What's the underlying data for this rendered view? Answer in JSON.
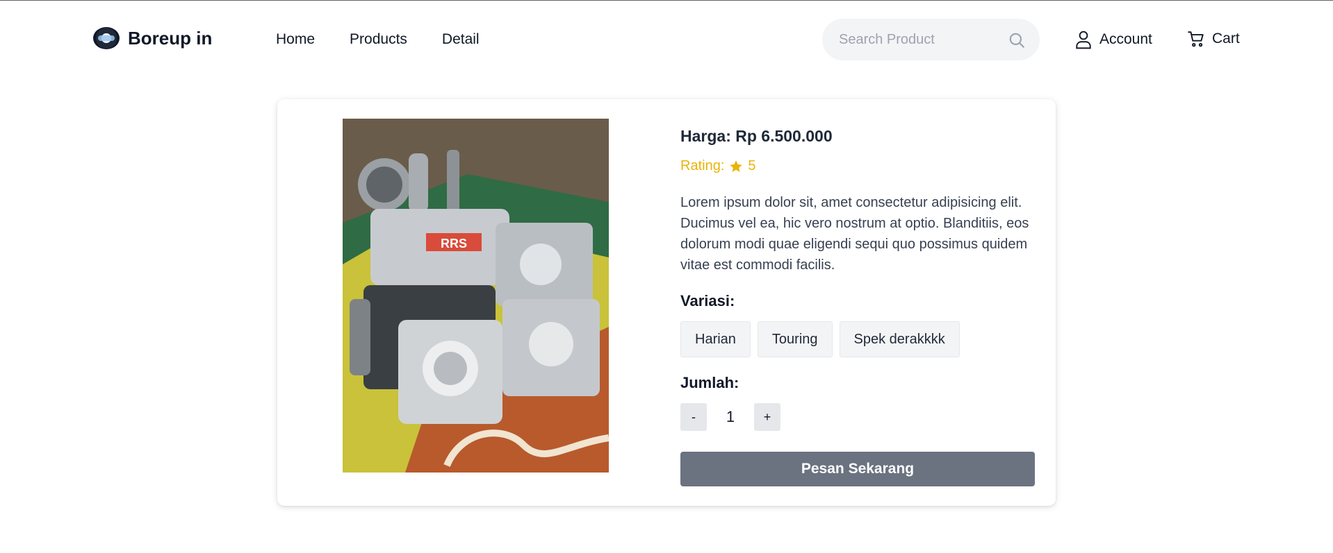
{
  "brand": {
    "name": "Boreup in"
  },
  "nav": {
    "items": [
      "Home",
      "Products",
      "Detail"
    ]
  },
  "search": {
    "placeholder": "Search Product",
    "icon": "search-icon"
  },
  "account": {
    "label": "Account",
    "icon": "user-icon"
  },
  "cart": {
    "label": "Cart",
    "icon": "cart-icon"
  },
  "product": {
    "price": "Harga: Rp 6.500.000",
    "rating_label": "Rating:",
    "rating_value": "5",
    "description": "Lorem ipsum dolor sit, amet consectetur adipisicing elit. Ducimus vel ea, hic vero nostrum at optio. Blanditiis, eos dolorum modi quae eligendi sequi quo possimus quidem vitae est commodi facilis.",
    "variants_label": "Variasi:",
    "variants": [
      "Harian",
      "Touring",
      "Spek derakkkk"
    ],
    "quantity_label": "Jumlah:",
    "quantity_minus": "-",
    "quantity": "1",
    "quantity_plus": "+",
    "order_label": "Pesan Sekarang",
    "image_text": "RRS"
  },
  "colors": {
    "rating": "#eab308",
    "order_button": "#6b7280",
    "chip_bg": "#f3f4f6"
  }
}
